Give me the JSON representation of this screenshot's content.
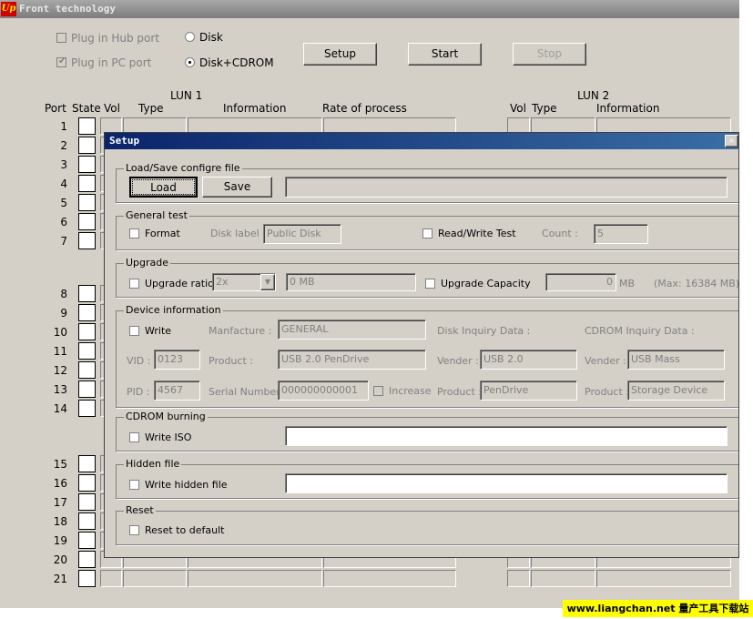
{
  "window": {
    "title": "Front technology",
    "logo": "Up"
  },
  "top": {
    "plug_hub": "Plug in Hub port",
    "plug_pc": "Plug in PC port",
    "radio_disk": "Disk",
    "radio_disk_cdrom": "Disk+CDROM",
    "setup": "Setup",
    "start": "Start",
    "stop": "Stop"
  },
  "table": {
    "lun1": "LUN 1",
    "lun2": "LUN 2",
    "headers": {
      "port": "Port",
      "state": "State",
      "vol": "Vol",
      "type": "Type",
      "info": "Information",
      "rate": "Rate of process"
    },
    "ports": [
      "1",
      "2",
      "3",
      "4",
      "5",
      "6",
      "7",
      "8",
      "9",
      "10",
      "11",
      "12",
      "13",
      "14",
      "15",
      "16",
      "17",
      "18",
      "19",
      "20",
      "21"
    ]
  },
  "dialog": {
    "title": "Setup",
    "loadsave": {
      "title": "Load/Save configre file",
      "load": "Load",
      "save": "Save",
      "path": ""
    },
    "general": {
      "title": "General test",
      "format": "Format",
      "disk_label_lbl": "Disk label :",
      "disk_label": "Public Disk",
      "rw_test": "Read/Write Test",
      "count_lbl": "Count :",
      "count": "5"
    },
    "upgrade": {
      "title": "Upgrade",
      "ratio": "Upgrade ratio",
      "ratio_value": "2x",
      "mb_value": "0 MB",
      "capacity": "Upgrade Capacity",
      "cap_value": "0",
      "mb": "MB",
      "max": "(Max: 16384 MB)"
    },
    "device": {
      "title": "Device information",
      "write": "Write",
      "manufacture_lbl": "Manfacture :",
      "manufacture": "GENERAL",
      "disk_inquiry": "Disk Inquiry Data :",
      "cdrom_inquiry": "CDROM Inquiry Data :",
      "vid_lbl": "VID :",
      "vid": "0123",
      "product_lbl": "Product :",
      "product": "USB 2.0 PenDrive",
      "vender_lbl": "Vender :",
      "disk_vender": "USB 2.0",
      "cd_vender": "USB Mass",
      "pid_lbl": "PID :",
      "pid": "4567",
      "serial_lbl": "Serial Number :",
      "serial": "000000000001",
      "increase": "Increase",
      "disk_product": "PenDrive",
      "cd_product": "Storage Device"
    },
    "cdrom": {
      "title": "CDROM burning",
      "write_iso": "Write ISO",
      "path": ""
    },
    "hidden": {
      "title": "Hidden file",
      "write_hidden": "Write hidden file",
      "path": ""
    },
    "reset": {
      "title": "Reset",
      "reset_default": "Reset to default"
    }
  },
  "watermark": "www.liangchan.net 量产工具下载站"
}
